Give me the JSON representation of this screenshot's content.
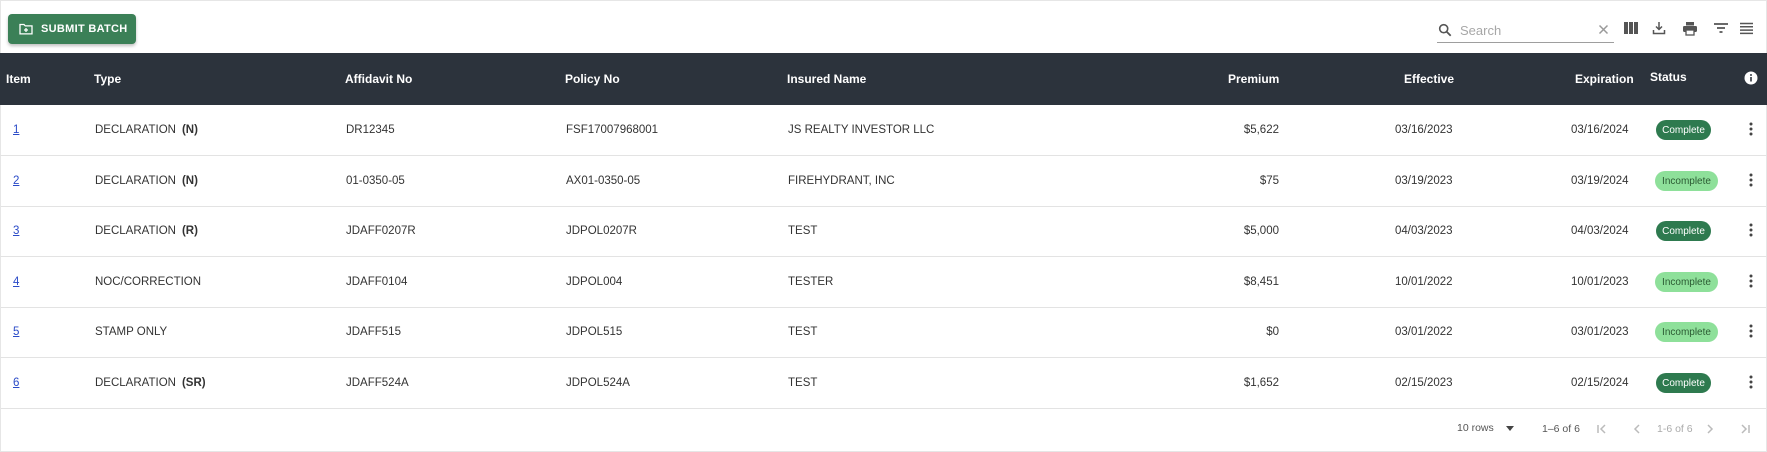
{
  "toolbar": {
    "submit_label": "SUBMIT BATCH",
    "search_placeholder": "Search",
    "search_value": ""
  },
  "icons": {
    "submit": "folder-plus-icon",
    "search": "search-icon",
    "clear": "close-icon",
    "columns": "columns-icon",
    "export": "download-icon",
    "print": "print-icon",
    "filter": "filter-icon",
    "density": "density-icon",
    "info": "info-icon",
    "row_menu": "more-vert-icon"
  },
  "table": {
    "headers": {
      "item": "Item",
      "type": "Type",
      "affidavit": "Affidavit No",
      "policy": "Policy No",
      "insured": "Insured Name",
      "premium": "Premium",
      "effective": "Effective",
      "expiration": "Expiration",
      "status": "Status"
    },
    "rows": [
      {
        "item": "1",
        "type": "DECLARATION",
        "type_code": "(N)",
        "affidavit": "DR12345",
        "policy": "FSF17007968001",
        "insured": "JS REALTY INVESTOR LLC",
        "premium": "$5,622",
        "effective": "03/16/2023",
        "expiration": "03/16/2024",
        "status": "Complete"
      },
      {
        "item": "2",
        "type": "DECLARATION",
        "type_code": "(N)",
        "affidavit": "01-0350-05",
        "policy": "AX01-0350-05",
        "insured": "FIREHYDRANT, INC",
        "premium": "$75",
        "effective": "03/19/2023",
        "expiration": "03/19/2024",
        "status": "Incomplete"
      },
      {
        "item": "3",
        "type": "DECLARATION",
        "type_code": "(R)",
        "affidavit": "JDAFF0207R",
        "policy": "JDPOL0207R",
        "insured": "TEST",
        "premium": "$5,000",
        "effective": "04/03/2023",
        "expiration": "04/03/2024",
        "status": "Complete"
      },
      {
        "item": "4",
        "type": "NOC/CORRECTION",
        "type_code": "",
        "affidavit": "JDAFF0104",
        "policy": "JDPOL004",
        "insured": "TESTER",
        "premium": "$8,451",
        "effective": "10/01/2022",
        "expiration": "10/01/2023",
        "status": "Incomplete"
      },
      {
        "item": "5",
        "type": "STAMP ONLY",
        "type_code": "",
        "affidavit": "JDAFF515",
        "policy": "JDPOL515",
        "insured": "TEST",
        "premium": "$0",
        "effective": "03/01/2022",
        "expiration": "03/01/2023",
        "status": "Incomplete"
      },
      {
        "item": "6",
        "type": "DECLARATION",
        "type_code": "(SR)",
        "affidavit": "JDAFF524A",
        "policy": "JDPOL524A",
        "insured": "TEST",
        "premium": "$1,652",
        "effective": "02/15/2023",
        "expiration": "02/15/2024",
        "status": "Complete"
      }
    ]
  },
  "footer": {
    "rows_per_page": "10 rows",
    "range_left": "1–6 of 6",
    "range_right": "1-6 of 6"
  },
  "colors": {
    "primary_button": "#3b8057",
    "header_bg": "#2c333c",
    "complete_badge": "#2e7a4f",
    "incomplete_badge": "#8ee09a",
    "link": "#2a4ac7"
  }
}
